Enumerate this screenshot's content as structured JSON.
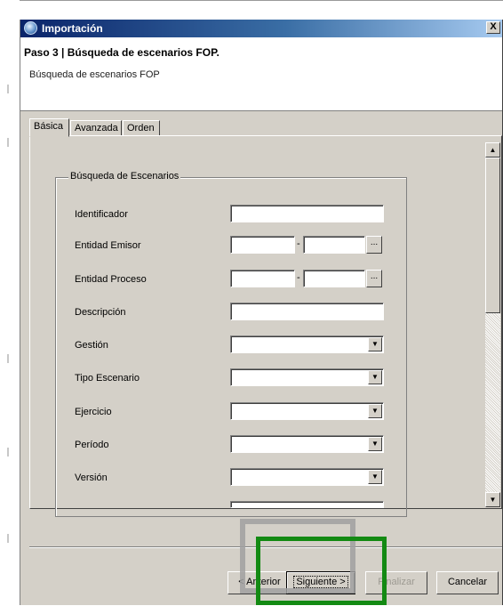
{
  "window": {
    "title": "Importación",
    "close_glyph": "X"
  },
  "header": {
    "step_title": "Paso 3 | Búsqueda de escenarios FOP.",
    "step_description": "Búsqueda de escenarios FOP"
  },
  "tabs": [
    {
      "label": "Básica",
      "active": true
    },
    {
      "label": "Avanzada",
      "active": false
    },
    {
      "label": "Orden",
      "active": false
    }
  ],
  "search_group": {
    "legend": "Búsqueda de Escenarios",
    "fields": [
      {
        "label": "Identificador",
        "type": "text",
        "value": ""
      },
      {
        "label": "Entidad Emisor",
        "type": "range-lookup",
        "separator": "-",
        "button": "..."
      },
      {
        "label": "Entidad Proceso",
        "type": "range-lookup",
        "separator": "-",
        "button": "..."
      },
      {
        "label": "Descripción",
        "type": "text",
        "value": ""
      },
      {
        "label": "Gestión",
        "type": "select",
        "value": ""
      },
      {
        "label": "Tipo Escenario",
        "type": "select",
        "value": ""
      },
      {
        "label": "Ejercicio",
        "type": "select",
        "value": ""
      },
      {
        "label": "Período",
        "type": "select",
        "value": ""
      },
      {
        "label": "Versión",
        "type": "select",
        "value": ""
      }
    ]
  },
  "buttons": {
    "previous": "< Anterior",
    "next": "Siguiente >",
    "finish": "Finalizar",
    "cancel": "Cancelar"
  },
  "icons": {
    "app": "globe-icon",
    "scroll_up": "scroll-up-arrow-icon",
    "scroll_down": "scroll-down-arrow-icon",
    "dropdown": "dropdown-arrow-icon"
  },
  "colors": {
    "highlight_green": "#138a13",
    "highlight_gray": "#a0a0a0",
    "dialog_face": "#d4d0c8"
  }
}
